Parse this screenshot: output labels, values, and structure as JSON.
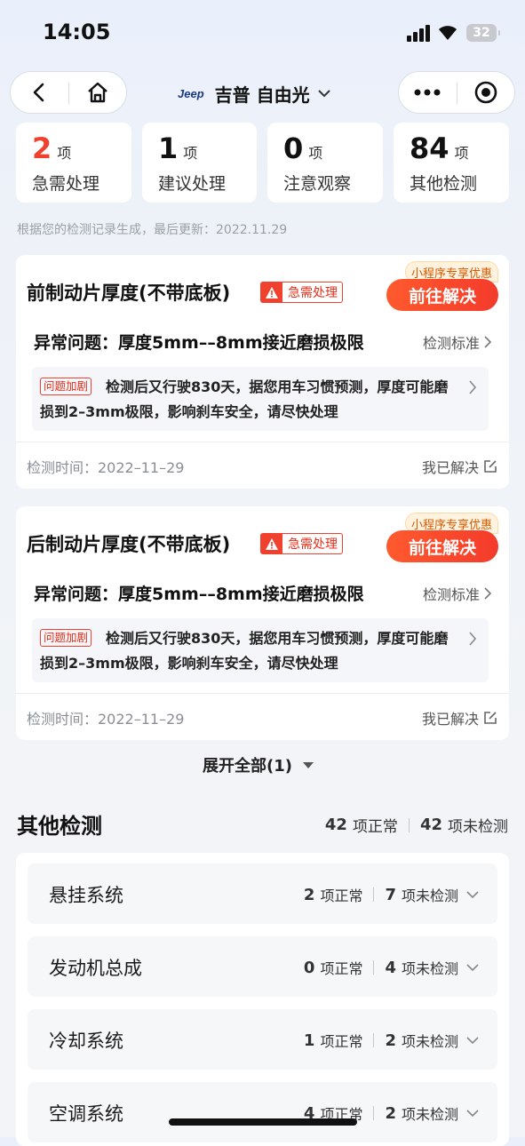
{
  "status": {
    "time": "14:05",
    "battery": "32"
  },
  "nav": {
    "brand": "Jeep",
    "title": "吉普 自由光"
  },
  "summary": [
    {
      "num": "2",
      "unit": "项",
      "label": "急需处理",
      "color": "#f0402e"
    },
    {
      "num": "1",
      "unit": "项",
      "label": "建议处理",
      "color": "#111111"
    },
    {
      "num": "0",
      "unit": "项",
      "label": "注意观察",
      "color": "#111111"
    },
    {
      "num": "84",
      "unit": "项",
      "label": "其他检测",
      "color": "#111111"
    }
  ],
  "update_text": "根据您的检测记录生成，最后更新：2022.11.29",
  "cards": [
    {
      "title": "前制动片厚度(不带底板)",
      "badge": "急需处理",
      "promo": "小程序专享优惠",
      "button": "前往解决",
      "issue": "异常问题：厚度5mm––8mm接近磨损极限",
      "standard": "检测标准",
      "detail_tag": "问题加剧",
      "detail": "检测后又行驶830天，据您用车习惯预测，厚度可能磨损到2–3mm极限，影响刹车安全，请尽快处理",
      "date": "检测时间：2022–11–29",
      "resolved": "我已解决"
    },
    {
      "title": "后制动片厚度(不带底板)",
      "badge": "急需处理",
      "promo": "小程序专享优惠",
      "button": "前往解决",
      "issue": "异常问题：厚度5mm––8mm接近磨损极限",
      "standard": "检测标准",
      "detail_tag": "问题加剧",
      "detail": "检测后又行驶830天，据您用车习惯预测，厚度可能磨损到2–3mm极限，影响刹车安全，请尽快处理",
      "date": "检测时间：2022–11–29",
      "resolved": "我已解决"
    }
  ],
  "expand_label": "展开全部(1)",
  "other": {
    "title": "其他检测",
    "normal_num": "42",
    "normal_label": "项正常",
    "untested_num": "42",
    "untested_label": "项未检测",
    "categories": [
      {
        "name": "悬挂系统",
        "normal": "2",
        "normal_label": "项正常",
        "untested": "7",
        "untested_label": "项未检测"
      },
      {
        "name": "发动机总成",
        "normal": "0",
        "normal_label": "项正常",
        "untested": "4",
        "untested_label": "项未检测"
      },
      {
        "name": "冷却系统",
        "normal": "1",
        "normal_label": "项正常",
        "untested": "2",
        "untested_label": "项未检测"
      },
      {
        "name": "空调系统",
        "normal": "4",
        "normal_label": "项正常",
        "untested": "2",
        "untested_label": "项未检测"
      }
    ]
  }
}
